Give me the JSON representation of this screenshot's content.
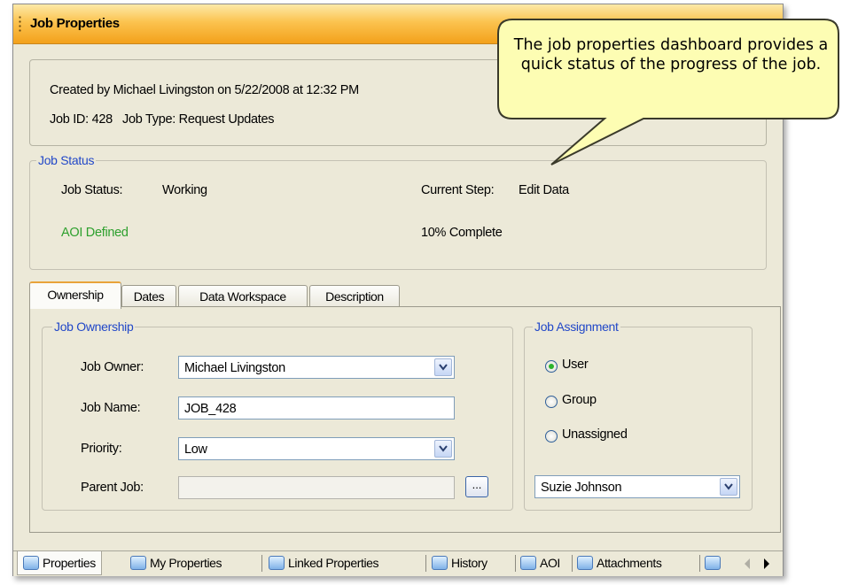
{
  "panel": {
    "title": "Job Properties",
    "created_line": "Created by Michael Livingston on 5/22/2008 at 12:32 PM",
    "job_id_line": "Job ID: 428   Job Type: Request Updates"
  },
  "job_status": {
    "legend": "Job Status",
    "status_label": "Job Status:",
    "status_value": "Working",
    "step_label": "Current Step:",
    "step_value": "Edit Data",
    "aoi_text": "AOI Defined",
    "percent_text": "10% Complete",
    "percent_complete": 10
  },
  "tabs": [
    {
      "label": "Ownership",
      "active": true
    },
    {
      "label": "Dates",
      "active": false
    },
    {
      "label": "Data Workspace",
      "active": false
    },
    {
      "label": "Description",
      "active": false
    }
  ],
  "ownership": {
    "legend": "Job Ownership",
    "owner_label": "Job Owner:",
    "owner_value": "Michael Livingston",
    "name_label": "Job Name:",
    "name_value": "JOB_428",
    "priority_label": "Priority:",
    "priority_value": "Low",
    "parent_label": "Parent Job:",
    "parent_value": "",
    "browse_label": "..."
  },
  "assignment": {
    "legend": "Job Assignment",
    "options": [
      {
        "label": "User",
        "selected": true
      },
      {
        "label": "Group",
        "selected": false
      },
      {
        "label": "Unassigned",
        "selected": false
      }
    ],
    "assignee_value": "Suzie Johnson"
  },
  "bottom_tabs": [
    {
      "label": "Properties",
      "active": true,
      "icon": "properties-icon"
    },
    {
      "label": "My Properties",
      "active": false,
      "icon": "my-properties-icon"
    },
    {
      "label": "Linked Properties",
      "active": false,
      "icon": "linked-properties-icon"
    },
    {
      "label": "History",
      "active": false,
      "icon": "history-icon"
    },
    {
      "label": "AOI",
      "active": false,
      "icon": "aoi-icon"
    },
    {
      "label": "Attachments",
      "active": false,
      "icon": "attachments-icon"
    }
  ],
  "callout": {
    "text": "The job properties dashboard provides a quick status of the progress of the job."
  },
  "colors": {
    "title_bar": "#f3a11b",
    "legend_text": "#2248c8",
    "aoi_defined": "#2ea02e",
    "callout_fill": "#fdfdb3"
  }
}
